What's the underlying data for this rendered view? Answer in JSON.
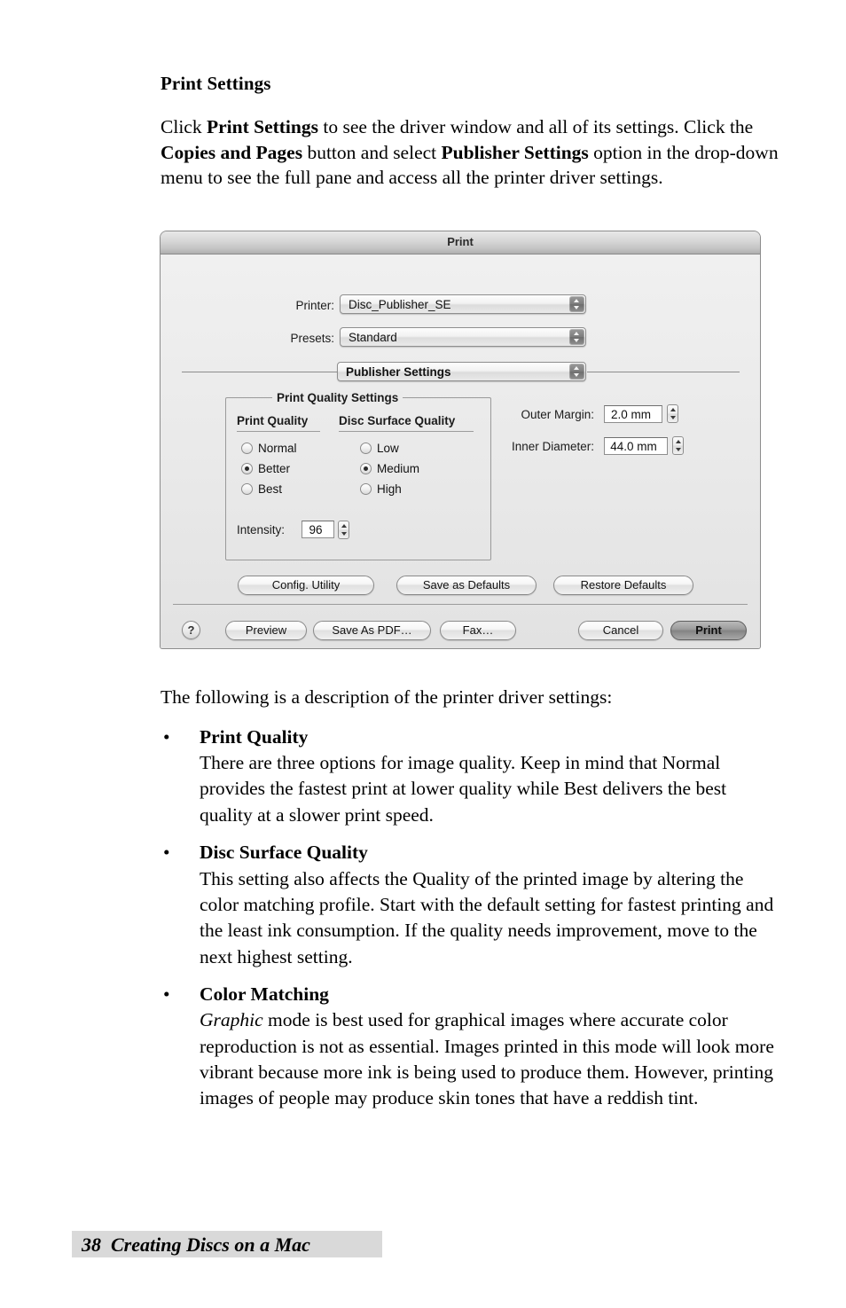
{
  "document": {
    "section_title": "Print Settings",
    "intro_parts": [
      {
        "text": "Click ",
        "bold": false
      },
      {
        "text": "Print Settings",
        "bold": true
      },
      {
        "text": " to see the driver window and all of its settings. Click the ",
        "bold": false
      },
      {
        "text": "Copies and Pages",
        "bold": true
      },
      {
        "text": " button and select ",
        "bold": false
      },
      {
        "text": "Publisher Settings",
        "bold": true
      },
      {
        "text": " option in the drop-down menu to see the full pane and access all the printer driver settings.",
        "bold": false
      }
    ],
    "lead_line": "The following is a description of the printer driver settings:",
    "bullets": [
      {
        "marker": "•",
        "title": "Print Quality",
        "body": "There are three options for image quality.  Keep in mind that Normal provides the fastest print at lower quality while Best delivers the best quality at a slower print speed."
      },
      {
        "marker": "•",
        "title": "Disc Surface Quality",
        "body": "This setting also affects the Quality of the printed image by altering the color matching profile. Start with the default setting for fastest printing and the least ink consumption.  If the quality needs improvement, move to the next highest setting."
      },
      {
        "marker": "•",
        "title": "Color Matching",
        "body_italic_lead": "Graphic",
        "body": " mode is best used for graphical images where accurate color reproduction is not as essential. Images printed in this mode will look more vibrant because more ink is being used to produce them. However, printing images of people may produce skin tones that have a reddish tint."
      }
    ],
    "footer": {
      "page_number": "38",
      "text": "38  Creating Discs on a Mac",
      "band_color": "#d9d9d9"
    }
  },
  "dialog": {
    "title": "Print",
    "printer": {
      "label": "Printer:",
      "value": "Disc_Publisher_SE"
    },
    "presets": {
      "label": "Presets:",
      "value": "Standard"
    },
    "pane_popup": {
      "value": "Publisher Settings"
    },
    "print_quality_settings": {
      "group_title": "Print Quality Settings",
      "print_quality": {
        "column_header": "Print Quality",
        "options": [
          "Normal",
          "Better",
          "Best"
        ],
        "selected": "Better"
      },
      "disc_surface_quality": {
        "column_header": "Disc Surface Quality",
        "options": [
          "Low",
          "Medium",
          "High"
        ],
        "selected": "Medium"
      },
      "intensity": {
        "label": "Intensity:",
        "value": "96"
      }
    },
    "margins": {
      "outer_margin": {
        "label": "Outer Margin:",
        "value": "2.0 mm"
      },
      "inner_diameter": {
        "label": "Inner Diameter:",
        "value": "44.0 mm"
      }
    },
    "action_buttons": {
      "config_utility": "Config. Utility",
      "save_as_defaults": "Save as Defaults",
      "restore_defaults": "Restore Defaults"
    },
    "bottom_buttons": {
      "help": "?",
      "preview": "Preview",
      "save_as_pdf": "Save As PDF…",
      "fax": "Fax…",
      "cancel": "Cancel",
      "print": "Print"
    }
  }
}
